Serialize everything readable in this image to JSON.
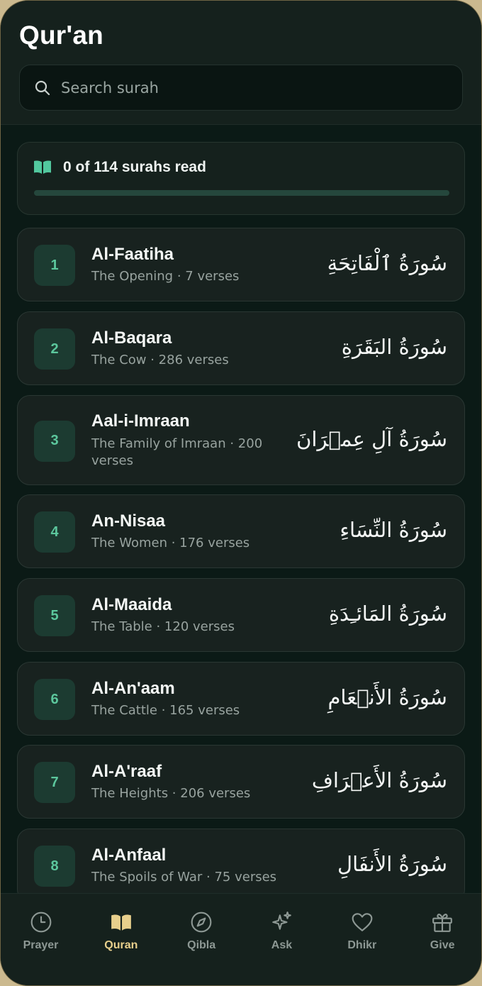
{
  "header": {
    "title": "Qur'an",
    "search_placeholder": "Search surah"
  },
  "progress": {
    "label": "0 of 114 surahs read",
    "read": 0,
    "total": 114
  },
  "surahs": [
    {
      "number": "1",
      "name": "Al-Faatiha",
      "subtitle": "The Opening · 7 verses",
      "arabic": "سُورَةُ ٱلْفَاتِحَةِ"
    },
    {
      "number": "2",
      "name": "Al-Baqara",
      "subtitle": "The Cow · 286 verses",
      "arabic": "سُورَةُ البَقَرَةِ"
    },
    {
      "number": "3",
      "name": "Aal-i-Imraan",
      "subtitle": "The Family of Imraan · 200 verses",
      "arabic": "سُورَةُ آلِ عِمۡرَانَ"
    },
    {
      "number": "4",
      "name": "An-Nisaa",
      "subtitle": "The Women · 176 verses",
      "arabic": "سُورَةُ النِّسَاءِ"
    },
    {
      "number": "5",
      "name": "Al-Maaida",
      "subtitle": "The Table · 120 verses",
      "arabic": "سُورَةُ المَائـِدَةِ"
    },
    {
      "number": "6",
      "name": "Al-An'aam",
      "subtitle": "The Cattle · 165 verses",
      "arabic": "سُورَةُ الأَنۡعَامِ"
    },
    {
      "number": "7",
      "name": "Al-A'raaf",
      "subtitle": "The Heights · 206 verses",
      "arabic": "سُورَةُ الأَعۡرَافِ"
    },
    {
      "number": "8",
      "name": "Al-Anfaal",
      "subtitle": "The Spoils of War · 75 verses",
      "arabic": "سُورَةُ الأَنفَالِ"
    }
  ],
  "tabs": [
    {
      "label": "Prayer",
      "icon": "clock-icon",
      "active": false
    },
    {
      "label": "Quran",
      "icon": "book-open-icon",
      "active": true
    },
    {
      "label": "Qibla",
      "icon": "compass-icon",
      "active": false
    },
    {
      "label": "Ask",
      "icon": "sparkles-icon",
      "active": false
    },
    {
      "label": "Dhikr",
      "icon": "heart-icon",
      "active": false
    },
    {
      "label": "Give",
      "icon": "gift-icon",
      "active": false
    }
  ],
  "colors": {
    "accent_green": "#4fd0a3",
    "active_tab": "#e7cf8c",
    "background": "#0b1a16"
  }
}
